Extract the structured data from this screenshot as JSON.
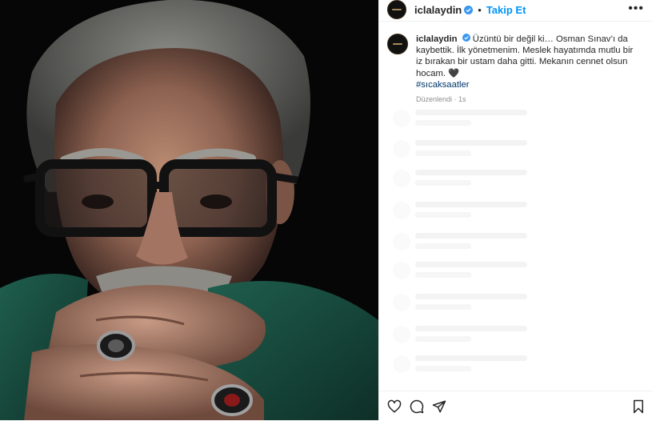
{
  "post": {
    "username": "iclalaydin",
    "follow_label": "Takip Et",
    "separator": "•",
    "more_label": "•••",
    "photo_alt": "Osman Sınav portresi"
  },
  "caption": {
    "username": "iclalaydin",
    "text": "Üzüntü bir değil ki… Osman Sınav’ı da kaybettik. İlk yönetmenim. Meslek hayatımda mutlu bir iz bırakan bir ustam daha gitti. Mekanın cennet olsun hocam. 🖤",
    "hashtag": "#sıcaksaatler",
    "edited": "Düzenlendi",
    "time": "1s"
  },
  "icons": {
    "verified": "verified-badge-icon",
    "like": "heart-icon",
    "comment": "comment-icon",
    "share": "paper-plane-icon",
    "save": "bookmark-icon"
  },
  "colors": {
    "link_blue": "#0095f6",
    "hashtag": "#00376b",
    "skeleton": "#f3f3f3"
  }
}
